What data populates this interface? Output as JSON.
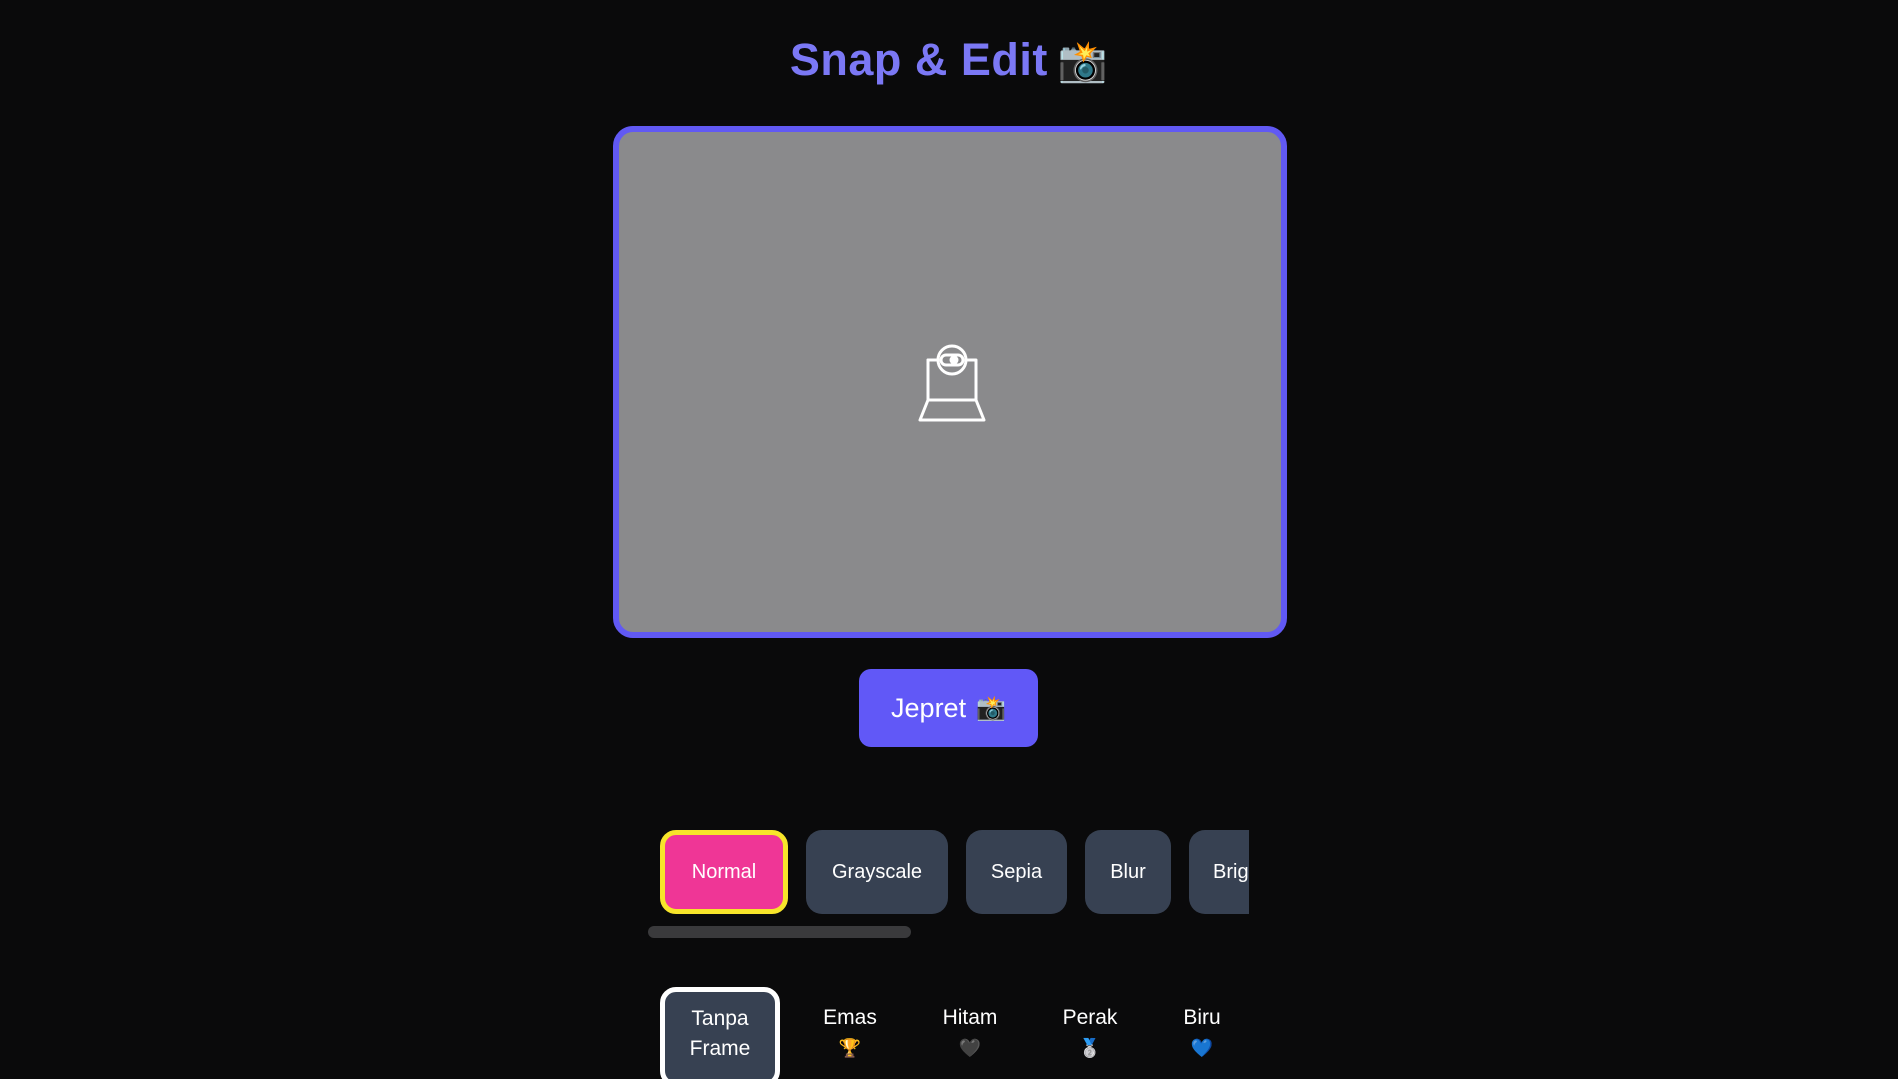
{
  "app": {
    "title": "Snap & Edit",
    "title_emoji": "📸"
  },
  "colors": {
    "background": "#0a0a0b",
    "accent": "#6159f4",
    "title": "#7b78f5",
    "active_filter": "#ef3696",
    "active_filter_border": "#f7e52a",
    "chip": "#374152"
  },
  "camera": {
    "placeholder_icon": "webcam-icon"
  },
  "snap_button": {
    "label": "Jepret",
    "emoji": "📸"
  },
  "filters": [
    {
      "label": "Normal",
      "active": true
    },
    {
      "label": "Grayscale",
      "active": false
    },
    {
      "label": "Sepia",
      "active": false
    },
    {
      "label": "Blur",
      "active": false
    },
    {
      "label": "Brightness",
      "active": false
    }
  ],
  "frames": [
    {
      "line1": "Tanpa",
      "line2": "Frame",
      "active": true
    },
    {
      "line1": "Emas",
      "line2": "🏆",
      "active": false
    },
    {
      "line1": "Hitam",
      "line2": "🖤",
      "active": false
    },
    {
      "line1": "Perak",
      "line2": "🥈",
      "active": false
    },
    {
      "line1": "Biru",
      "line2": "💙",
      "active": false
    }
  ]
}
